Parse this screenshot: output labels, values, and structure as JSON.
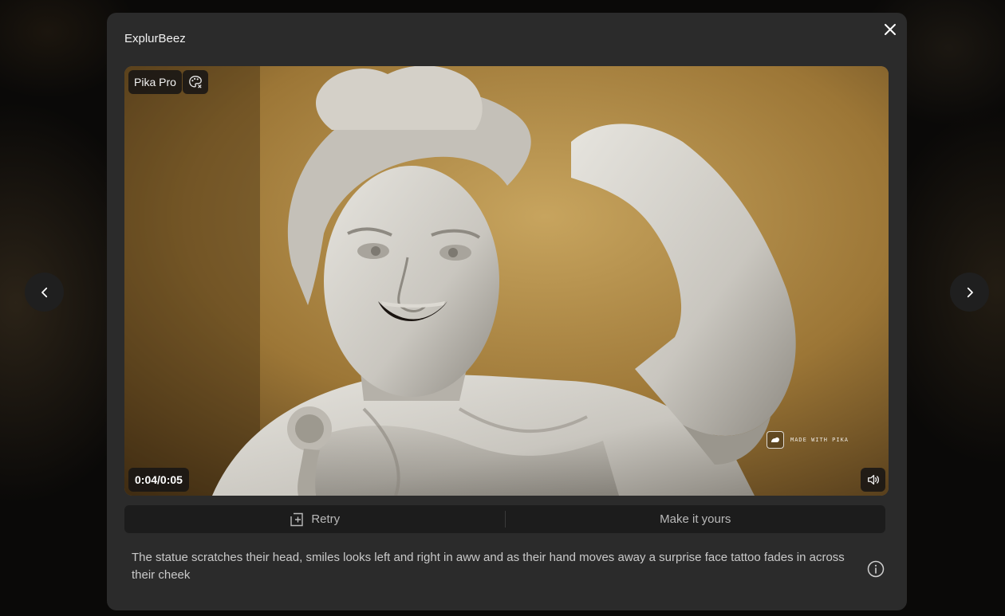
{
  "modal": {
    "title": "ExplurBeez"
  },
  "video": {
    "plan_badge": "Pika Pro",
    "time": "0:04/0:05",
    "watermark": "MADE WITH PIKA"
  },
  "actions": {
    "retry_label": "Retry",
    "make_label": "Make it yours"
  },
  "prompt": {
    "text": "The statue scratches their head, smiles looks left and right in aww and as their hand moves away a surprise face tattoo fades in across their cheek"
  },
  "icons": {
    "close": "close-icon",
    "prev": "chevron-left-icon",
    "next": "chevron-right-icon",
    "palette": "palette-icon",
    "volume": "volume-icon",
    "retry": "retry-icon",
    "info": "info-icon"
  },
  "colors": {
    "modal_bg": "#2b2b2b",
    "action_bar_bg": "#1c1c1c",
    "badge_bg": "#181614"
  }
}
